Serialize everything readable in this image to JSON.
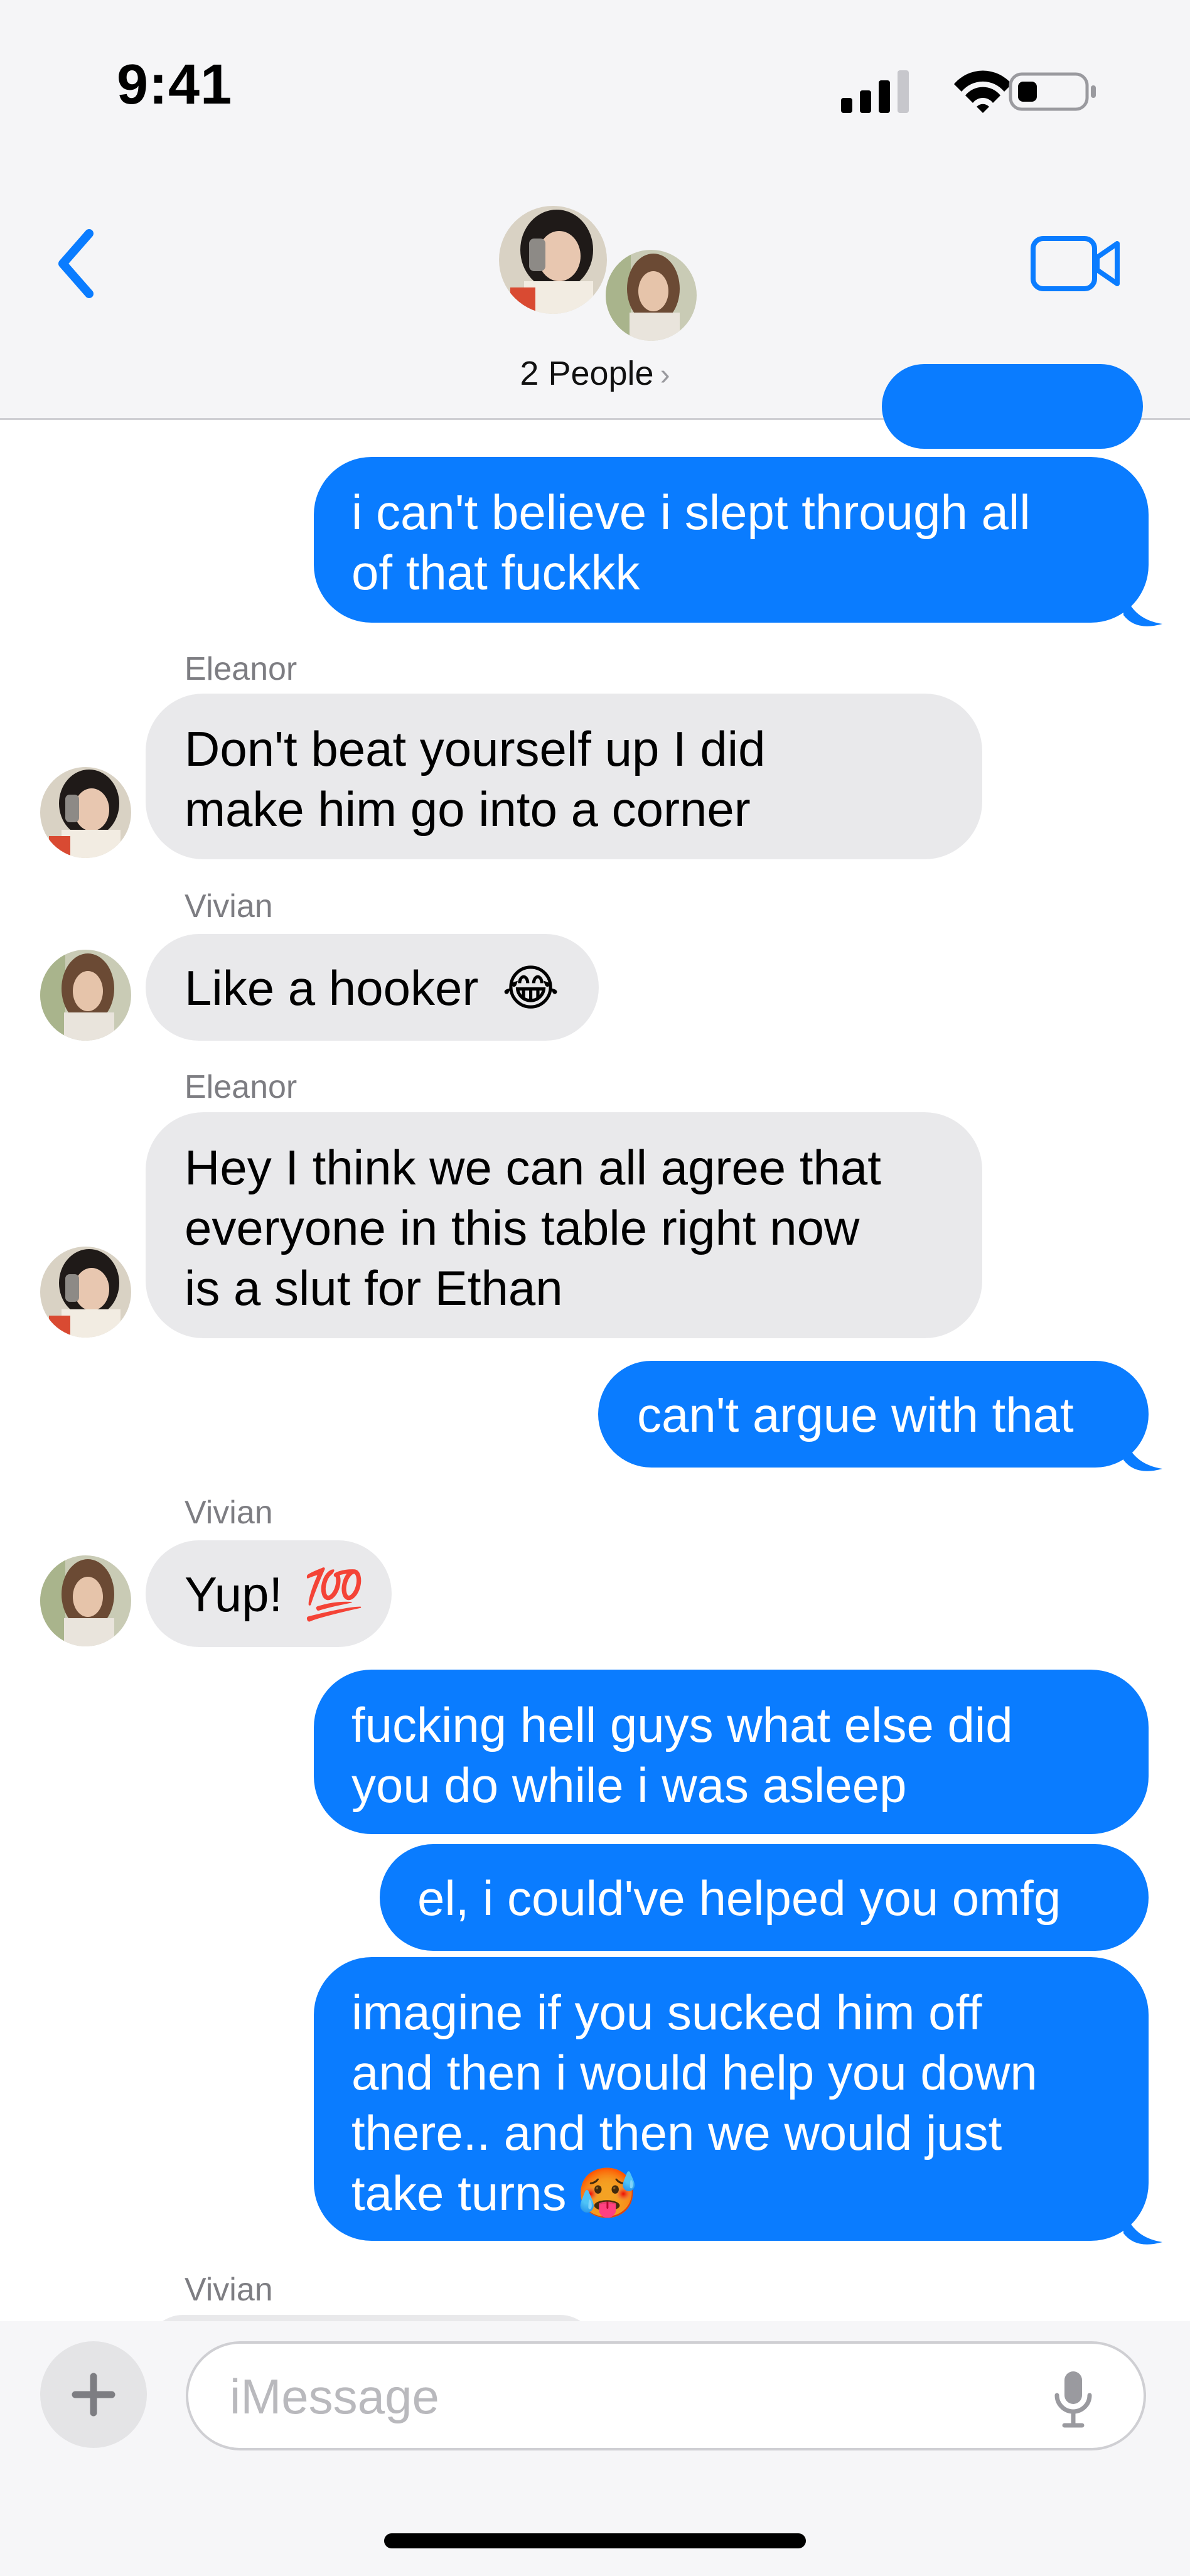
{
  "status_bar": {
    "time": "9:41"
  },
  "header": {
    "people_label": "2 People",
    "chevron": "›"
  },
  "messages": [
    {
      "type": "out",
      "lines": [
        "i can't believe i slept through all",
        "of that fuckkk"
      ]
    },
    {
      "type": "in",
      "sender": "Eleanor",
      "lines": [
        "Don't beat yourself up I did",
        "make him go into a corner"
      ]
    },
    {
      "type": "in",
      "sender": "Vivian",
      "lines": [
        "Like a hooker"
      ],
      "emoji": "😂"
    },
    {
      "type": "in",
      "sender": "Eleanor",
      "lines": [
        "Hey I think we can all agree that",
        "everyone in this table right now",
        "is a slut for Ethan"
      ]
    },
    {
      "type": "out",
      "lines": [
        "can't argue with that"
      ]
    },
    {
      "type": "in",
      "sender": "Vivian",
      "lines": [
        "Yup!"
      ],
      "emoji": "💯"
    },
    {
      "type": "out",
      "lines": [
        "fucking hell guys what else did",
        "you do while i was asleep"
      ]
    },
    {
      "type": "out",
      "lines": [
        "el, i could've helped you omfg"
      ]
    },
    {
      "type": "out",
      "lines": [
        "imagine if you sucked him off",
        "and then i would help you down",
        "there.. and then we would just",
        "take turns"
      ],
      "emoji": "🥵"
    },
    {
      "type": "in",
      "sender": "Vivian",
      "lines": []
    }
  ],
  "input": {
    "placeholder": "iMessage"
  },
  "colors": {
    "outgoing": "#0a7cff",
    "incoming": "#e9e9eb",
    "accent": "#0a7cff"
  },
  "icons": [
    "back-chevron-icon",
    "video-camera-icon",
    "plus-icon",
    "microphone-icon",
    "signal-icon",
    "wifi-icon",
    "battery-icon"
  ]
}
